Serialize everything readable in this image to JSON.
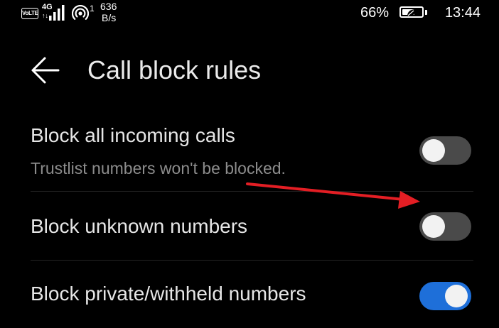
{
  "status_bar": {
    "volte_label": "VoLTE",
    "network_type": "4G",
    "network_arrows": "↑↓",
    "hotspot_count": "1",
    "speed_value": "636",
    "speed_unit": "B/s",
    "battery_percent": "66%",
    "battery_level": 0.66,
    "time": "13:44"
  },
  "header": {
    "back_icon": "arrow-left-icon",
    "title": "Call block rules"
  },
  "settings": [
    {
      "title": "Block all incoming calls",
      "subtitle": "Trustlist numbers won't be blocked.",
      "enabled": false
    },
    {
      "title": "Block unknown numbers",
      "enabled": false
    },
    {
      "title": "Block private/withheld numbers",
      "enabled": true
    }
  ],
  "colors": {
    "background": "#000000",
    "toggle_on": "#1e6fd9",
    "toggle_off": "#4a4a4a",
    "annotation_arrow": "#e31e24"
  }
}
